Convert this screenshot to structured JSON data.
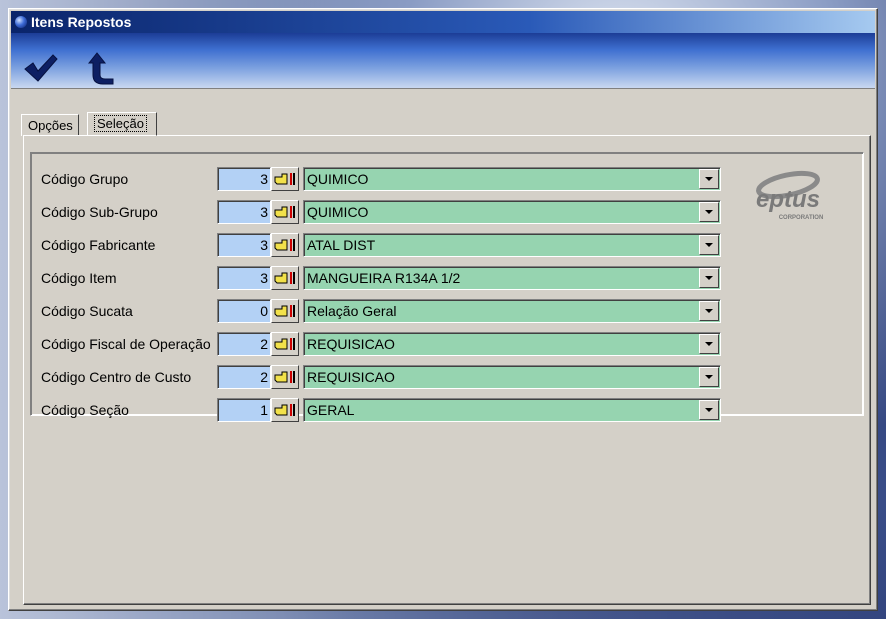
{
  "window": {
    "title": "Itens Repostos"
  },
  "toolbar": {
    "confirm_icon": "checkmark-icon",
    "back_icon": "return-arrow-icon"
  },
  "tabs": [
    {
      "label": "Opções",
      "active": false
    },
    {
      "label": "Seleção",
      "active": true
    }
  ],
  "fields": [
    {
      "label": "Código Grupo",
      "code": "3",
      "value": "QUIMICO"
    },
    {
      "label": "Código Sub-Grupo",
      "code": "3",
      "value": "QUIMICO"
    },
    {
      "label": "Código Fabricante",
      "code": "3",
      "value": "ATAL DIST"
    },
    {
      "label": "Código Item",
      "code": "3",
      "value": "MANGUEIRA R134A 1/2"
    },
    {
      "label": "Código Sucata",
      "code": "0",
      "value": "Relação Geral"
    },
    {
      "label": "Código Fiscal de Operação",
      "code": "2",
      "value": "REQUISICAO"
    },
    {
      "label": "Código Centro de Custo",
      "code": "2",
      "value": "REQUISICAO"
    },
    {
      "label": "Código Seção",
      "code": "1",
      "value": "GERAL"
    }
  ],
  "logo": {
    "brand": "eptus",
    "tagline": "CORPORATION"
  },
  "colors": {
    "code_field_bg": "#b3d1f5",
    "combo_bg": "#96d4b0",
    "titlebar": "#0a246a",
    "window_face": "#d4d0c8"
  }
}
